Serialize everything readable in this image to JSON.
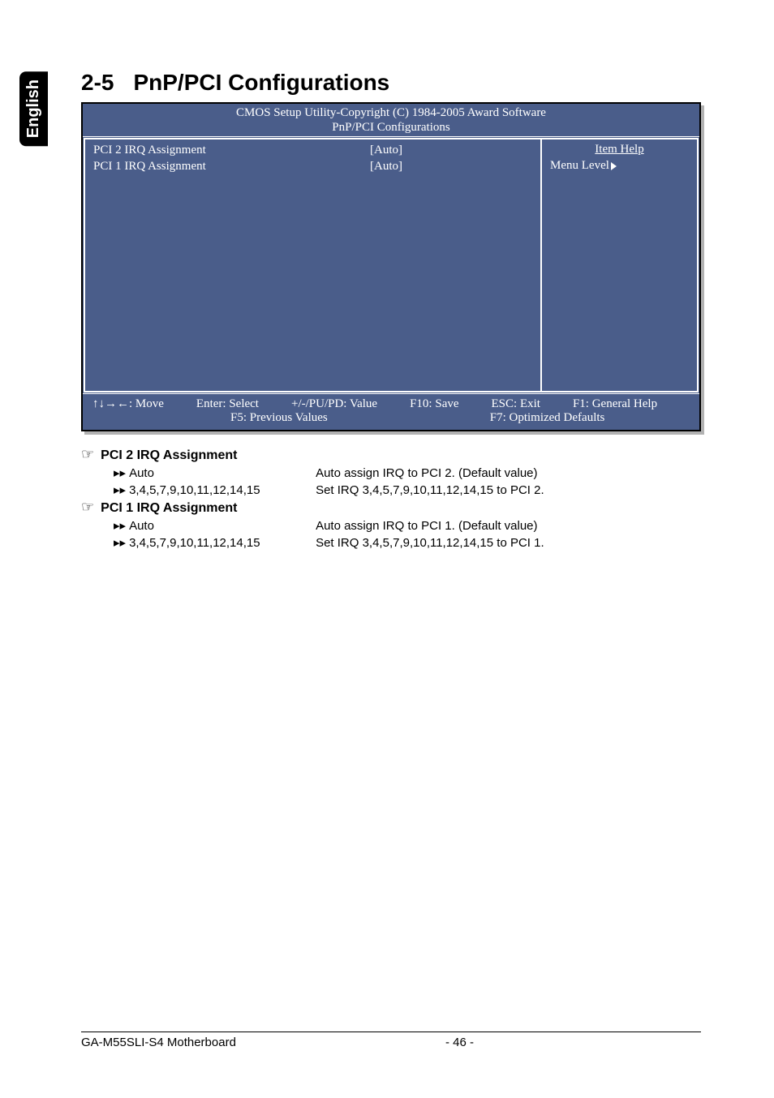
{
  "langTab": "English",
  "heading": {
    "num": "2-5",
    "title": "PnP/PCI Configurations"
  },
  "bios": {
    "title": "CMOS Setup Utility-Copyright (C) 1984-2005 Award Software",
    "subtitle": "PnP/PCI Configurations",
    "rows": [
      {
        "label": "PCI 2 IRQ Assignment",
        "value": "[Auto]"
      },
      {
        "label": "PCI 1 IRQ Assignment",
        "value": "[Auto]"
      }
    ],
    "itemHelp": "Item Help",
    "menuLevel": "Menu Level",
    "footer1": {
      "move": "↑↓→←: Move",
      "enter": "Enter: Select",
      "value": "+/-/PU/PD: Value",
      "save": "F10: Save",
      "esc": "ESC: Exit",
      "help": "F1: General Help"
    },
    "footer2": {
      "prev": "F5: Previous Values",
      "opt": "F7: Optimized Defaults"
    }
  },
  "options": [
    {
      "header": "PCI 2 IRQ Assignment",
      "items": [
        {
          "key": "Auto",
          "desc": "Auto assign IRQ to PCI 2. (Default value)"
        },
        {
          "key": "3,4,5,7,9,10,11,12,14,15",
          "desc": "Set IRQ 3,4,5,7,9,10,11,12,14,15 to PCI 2."
        }
      ]
    },
    {
      "header": "PCI 1 IRQ Assignment",
      "items": [
        {
          "key": "Auto",
          "desc": "Auto assign IRQ to PCI 1. (Default value)"
        },
        {
          "key": "3,4,5,7,9,10,11,12,14,15",
          "desc": "Set IRQ 3,4,5,7,9,10,11,12,14,15 to PCI 1."
        }
      ]
    }
  ],
  "pageFooter": {
    "title": "GA-M55SLI-S4 Motherboard",
    "pnum": "- 46 -"
  }
}
